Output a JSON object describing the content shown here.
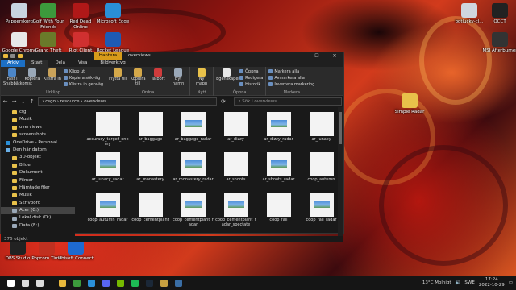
{
  "desktop": {
    "icons_left": [
      {
        "label": "Papperskorg",
        "color": "#c8d4e0"
      },
      {
        "label": "Golf With Your Friends",
        "color": "#3c9a3c"
      },
      {
        "label": "Red Dead Online",
        "color": "#b01818"
      },
      {
        "label": "Microsoft Edge",
        "color": "#2a8fd8"
      },
      {
        "label": "Google Chrome",
        "color": "#e8e8e8"
      },
      {
        "label": "Grand Theft Auto V",
        "color": "#6a7a2a"
      },
      {
        "label": "Riot Client",
        "color": "#d03030"
      },
      {
        "label": "Rocket League",
        "color": "#1e5ab4"
      }
    ],
    "icons_right": [
      {
        "label": "botlucky-cl...",
        "color": "#cfd6de"
      },
      {
        "label": "OCCT",
        "color": "#222222"
      },
      {
        "label": "MSI Afterburner",
        "color": "#333333"
      }
    ],
    "simple_radar": {
      "label": "Simple Radar",
      "color": "#e8c14a"
    },
    "icons_bottom": [
      {
        "label": "OBS Studio",
        "color": "#222222"
      },
      {
        "label": "Popcorn Time",
        "color": "#c03020"
      },
      {
        "label": "Ubisoft Connect",
        "color": "#1e6ad0"
      }
    ]
  },
  "explorer": {
    "manage_label": "Hantera",
    "title": "overviews",
    "controls": [
      "—",
      "☐",
      "✕"
    ],
    "tabs": [
      "Arkiv",
      "Start",
      "Dela",
      "Visa",
      "Bildverktyg"
    ],
    "ribbon": {
      "clipboard": {
        "name": "Urklipp",
        "pin": "Fäst i Snabbåtkomst",
        "copy": "Kopiera",
        "paste": "Klistra in",
        "small": [
          "Klipp ut",
          "Kopiera sökväg",
          "Klistra in genväg"
        ]
      },
      "organize": {
        "name": "Ordna",
        "move": "Flytta till",
        "copyto": "Kopiera till",
        "delete": "Ta bort",
        "rename": "Byt namn"
      },
      "new": {
        "name": "Nytt",
        "folder": "Ny mapp"
      },
      "open": {
        "name": "Öppna",
        "properties": "Egenskaper",
        "small": [
          "Öppna",
          "Redigera",
          "Historik"
        ]
      },
      "select": {
        "name": "Markera",
        "small": [
          "Markera alla",
          "Avmarkera alla",
          "Invertera markering"
        ]
      }
    },
    "address": {
      "path": [
        "csgo",
        "resource",
        "overviews"
      ],
      "separator": "›",
      "search_placeholder": "Sök i overviews"
    },
    "nav": [
      {
        "label": "cfg",
        "icon": "folder"
      },
      {
        "label": "Musik",
        "icon": "folder"
      },
      {
        "label": "overviews",
        "icon": "folder"
      },
      {
        "label": "screenshots",
        "icon": "folder"
      },
      {
        "label": "OneDrive - Personal",
        "icon": "cloud"
      },
      {
        "label": "Den här datorn",
        "icon": "pc"
      },
      {
        "label": "3D-objekt",
        "icon": "folder"
      },
      {
        "label": "Bilder",
        "icon": "folder"
      },
      {
        "label": "Dokument",
        "icon": "folder"
      },
      {
        "label": "Filmer",
        "icon": "folder"
      },
      {
        "label": "Hämtade filer",
        "icon": "folder"
      },
      {
        "label": "Musik",
        "icon": "folder"
      },
      {
        "label": "Skrivbord",
        "icon": "folder"
      },
      {
        "label": "Acer (C:)",
        "icon": "drive",
        "selected": true
      },
      {
        "label": "Lokal disk (D:)",
        "icon": "drive"
      },
      {
        "label": "Data (E:)",
        "icon": "drive"
      }
    ],
    "files": [
      {
        "name": "accuracy_target_enemy",
        "image": false
      },
      {
        "name": "ar_baggage",
        "image": false
      },
      {
        "name": "ar_baggage_radar",
        "image": true
      },
      {
        "name": "ar_dizzy",
        "image": false
      },
      {
        "name": "ar_dizzy_radar",
        "image": true
      },
      {
        "name": "ar_lunacy",
        "image": false
      },
      {
        "name": "ar_lunacy_radar",
        "image": true
      },
      {
        "name": "ar_monastery",
        "image": false
      },
      {
        "name": "ar_monastery_radar",
        "image": true
      },
      {
        "name": "ar_shoots",
        "image": false
      },
      {
        "name": "ar_shoots_radar",
        "image": true
      },
      {
        "name": "coop_autumn",
        "image": false
      },
      {
        "name": "coop_autumn_radar",
        "image": true
      },
      {
        "name": "coop_cementplant",
        "image": false
      },
      {
        "name": "coop_cementplant_radar",
        "image": true
      },
      {
        "name": "coop_cementplant_radar_spectate",
        "image": true
      },
      {
        "name": "coop_fall",
        "image": false
      },
      {
        "name": "coop_fall_radar",
        "image": true
      }
    ],
    "status": "376 objekt"
  },
  "taskbar": {
    "apps": [
      {
        "name": "start-icon",
        "color": "#ffffff"
      },
      {
        "name": "search-icon",
        "color": "#dddddd"
      },
      {
        "name": "task-view-icon",
        "color": "#dddddd"
      },
      {
        "name": "explorer-icon",
        "color": "#e8b83c"
      },
      {
        "name": "chrome-icon",
        "color": "#3c9a3c"
      },
      {
        "name": "edge-icon",
        "color": "#2a8fd8"
      },
      {
        "name": "discord-icon",
        "color": "#5865f2"
      },
      {
        "name": "nvidia-icon",
        "color": "#76b900"
      },
      {
        "name": "spotify-icon",
        "color": "#1db954"
      },
      {
        "name": "steam-icon",
        "color": "#1b2838"
      },
      {
        "name": "csgo-icon",
        "color": "#c7a040"
      },
      {
        "name": "app-icon",
        "color": "#3a6ea5"
      }
    ],
    "weather": "13°C Molnigt",
    "language": "SWE",
    "time": "17:24",
    "date": "2022-10-29"
  }
}
